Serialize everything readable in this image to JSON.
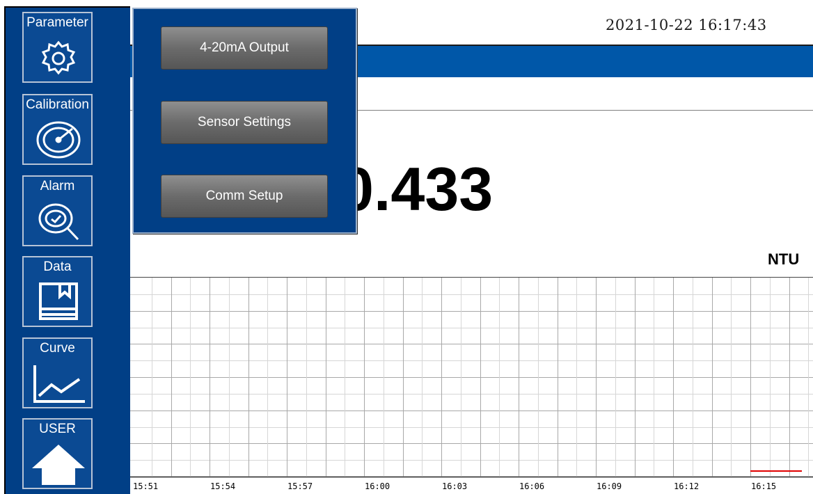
{
  "sidebar": {
    "items": [
      {
        "label": "Parameter",
        "icon": "gear-icon"
      },
      {
        "label": "Calibration",
        "icon": "gauge-icon"
      },
      {
        "label": "Alarm",
        "icon": "alarm-magnifier-icon"
      },
      {
        "label": "Data",
        "icon": "data-folder-icon"
      },
      {
        "label": "Curve",
        "icon": "line-chart-icon"
      },
      {
        "label": "USER",
        "icon": "home-icon"
      }
    ]
  },
  "header": {
    "datetime": "2021-10-22 16:17:43"
  },
  "reading": {
    "value": "0.433",
    "unit": "NTU"
  },
  "param_menu": {
    "items": [
      "4-20mA Output",
      "Sensor Settings",
      "Comm Setup"
    ]
  },
  "colors": {
    "panel": "#013f86",
    "title_bar": "#0057a8",
    "trend_line": "#e00000",
    "grid": "#c8c8c8"
  },
  "chart_data": {
    "type": "line",
    "x_ticks": [
      "15:51",
      "15:54",
      "15:57",
      "16:00",
      "16:03",
      "16:06",
      "16:09",
      "16:12",
      "16:15"
    ],
    "series": [
      {
        "x": [
          "16:15",
          "16:17"
        ],
        "y": [
          0.433,
          0.433
        ]
      }
    ],
    "grid": true
  }
}
